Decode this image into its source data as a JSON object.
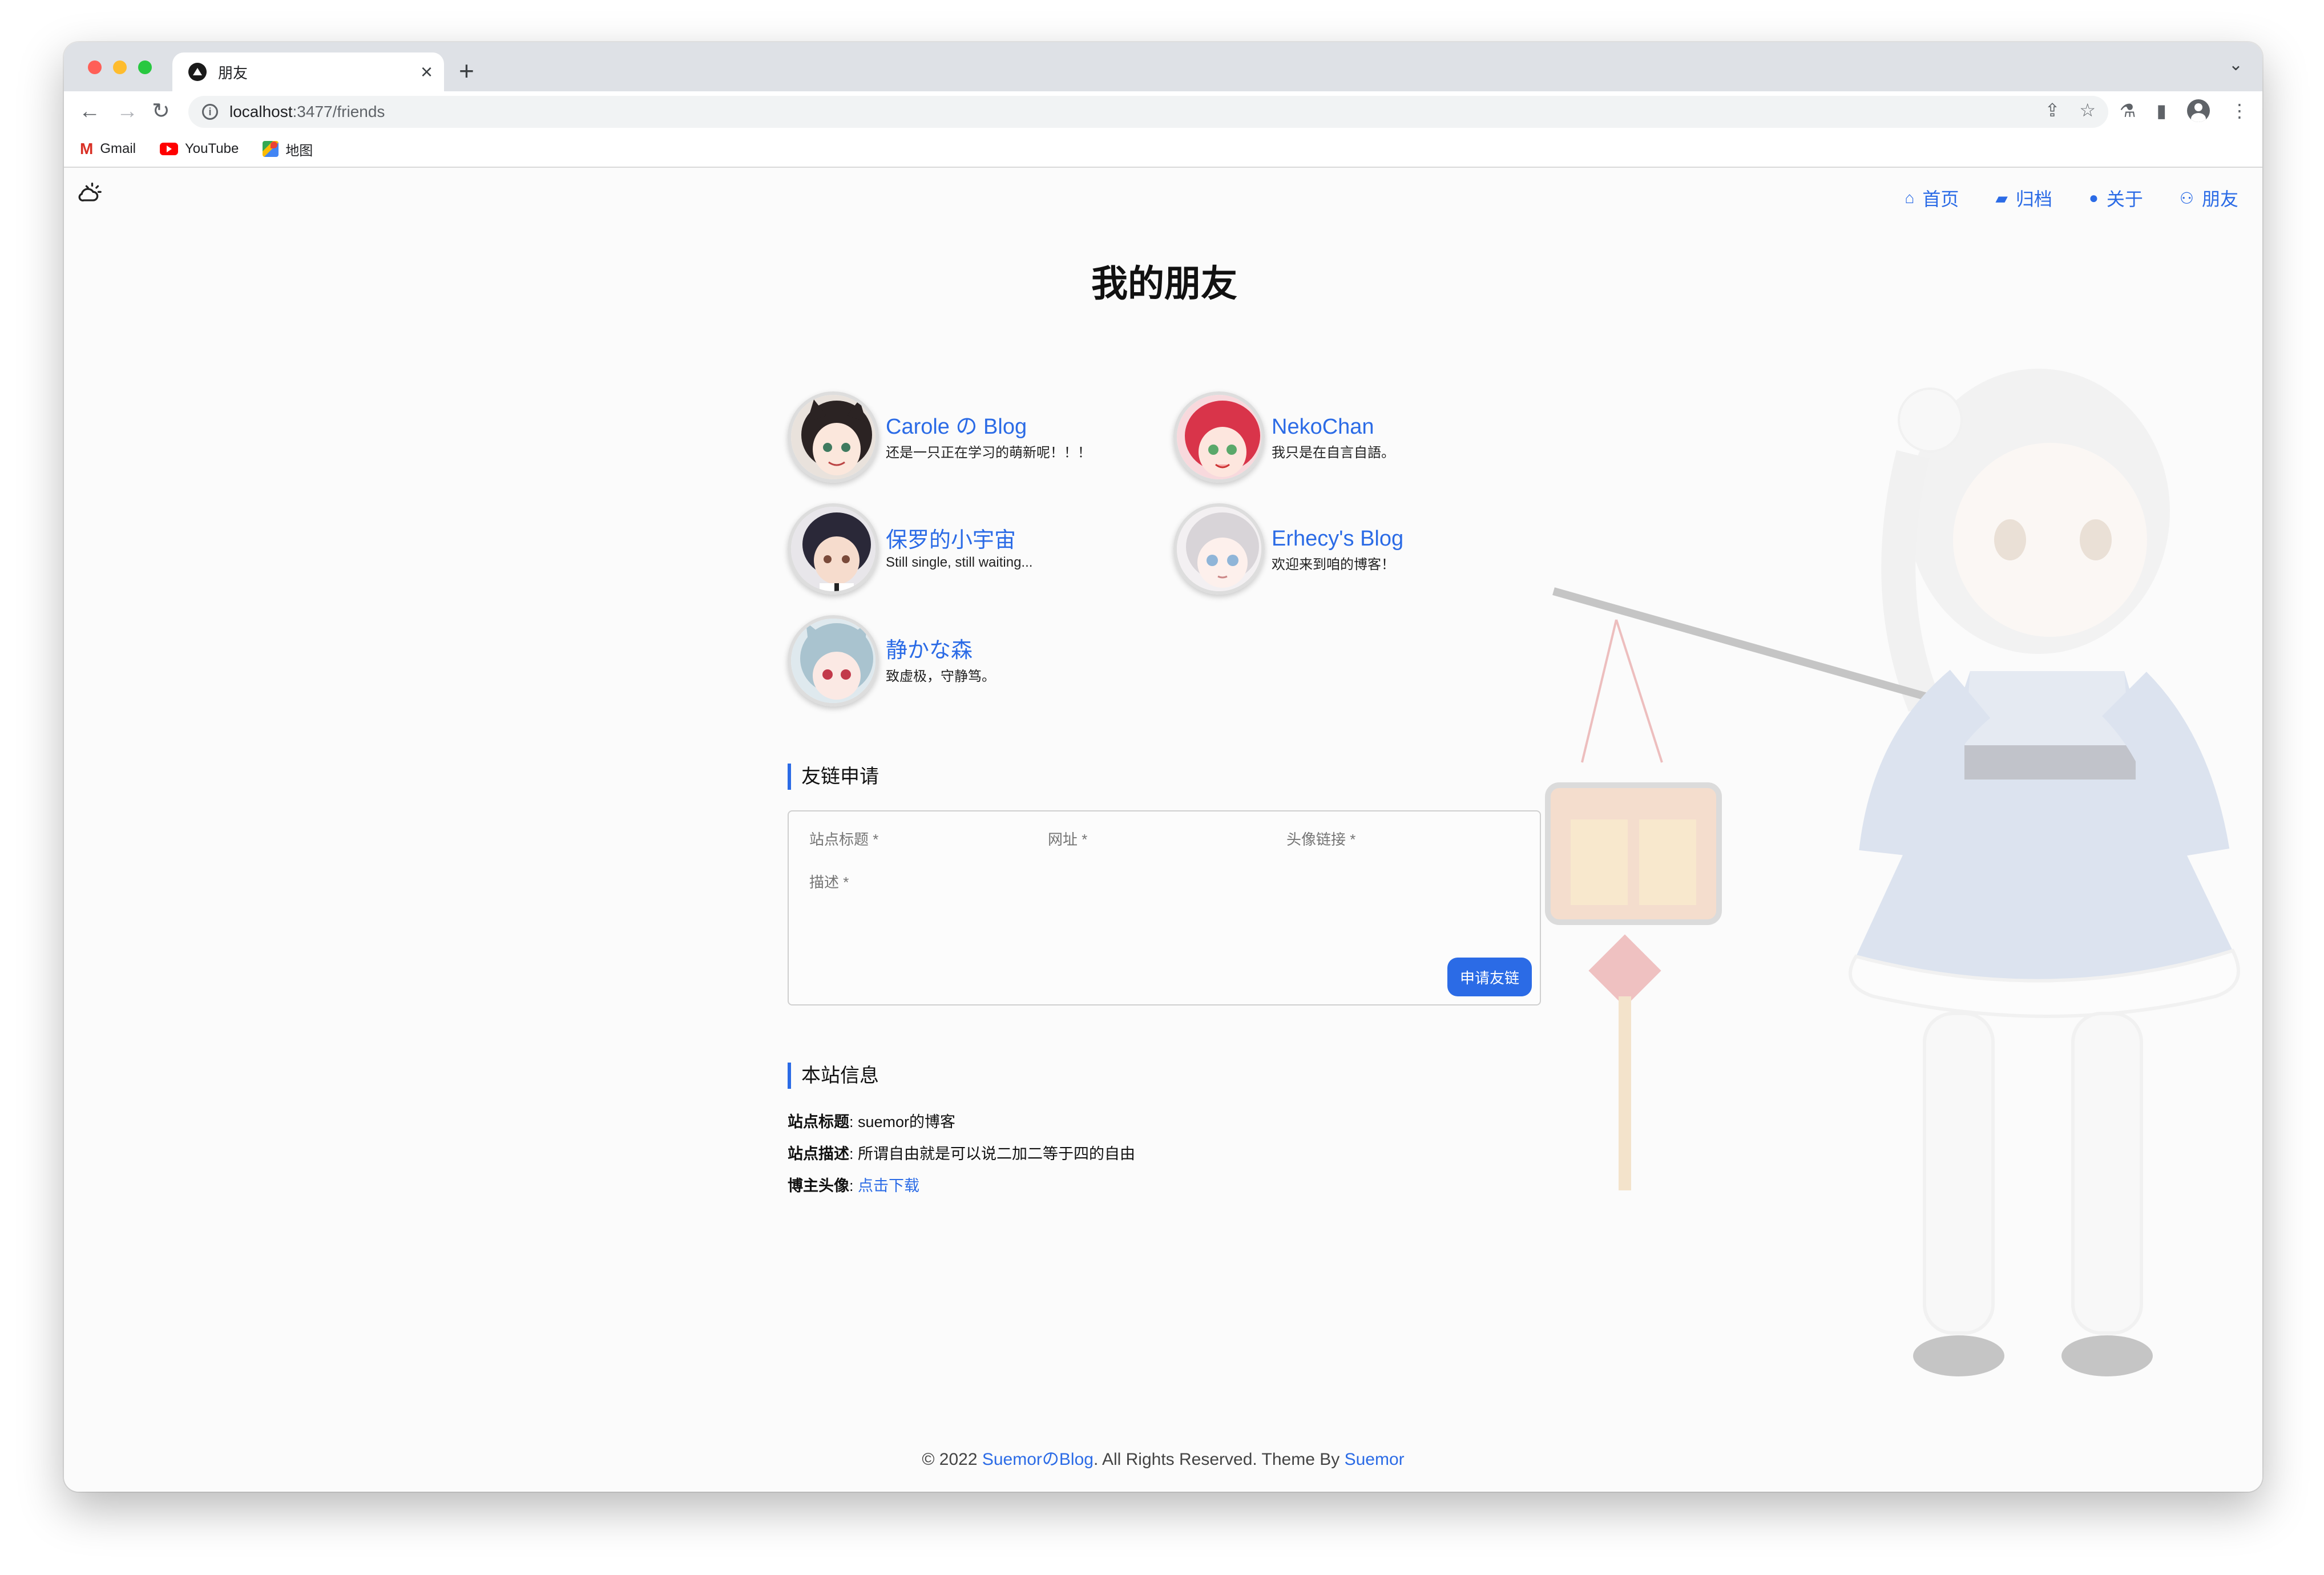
{
  "browser": {
    "tab_title": "朋友",
    "url_host": "localhost",
    "url_path": ":3477/friends",
    "bookmarks": [
      {
        "label": "Gmail"
      },
      {
        "label": "YouTube"
      },
      {
        "label": "地图"
      }
    ]
  },
  "site": {
    "nav": [
      {
        "label": "首页",
        "icon": "home-icon"
      },
      {
        "label": "归档",
        "icon": "archive-icon"
      },
      {
        "label": "关于",
        "icon": "user-icon"
      },
      {
        "label": "朋友",
        "icon": "users-icon"
      }
    ],
    "page_title": "我的朋友",
    "friends": [
      {
        "name": "Carole の Blog",
        "desc": "还是一只正在学习的萌新呢！！！"
      },
      {
        "name": "NekoChan",
        "desc": "我只是在自言自語。"
      },
      {
        "name": "保罗的小宇宙",
        "desc": "Still single, still waiting..."
      },
      {
        "name": "Erhecy's Blog",
        "desc": "欢迎来到咱的博客！"
      },
      {
        "name": "静かな森",
        "desc": "致虚极，守静笃。"
      }
    ],
    "apply": {
      "title": "友链申请",
      "site_title_placeholder": "站点标题 *",
      "url_placeholder": "网址 *",
      "avatar_placeholder": "头像链接 *",
      "desc_placeholder": "描述 *",
      "submit_label": "申请友链"
    },
    "site_info": {
      "title": "本站信息",
      "site_title_label": "站点标题",
      "site_title_value": "suemor的博客",
      "site_desc_label": "站点描述",
      "site_desc_value": "所谓自由就是可以说二加二等于四的自由",
      "avatar_label": "博主头像",
      "avatar_link": "点击下载"
    },
    "footer": {
      "copyright": "© 2022 ",
      "blog_link": "SuemorのBlog",
      "rights": ". All Rights Reserved. Theme By ",
      "author_link": "Suemor"
    }
  }
}
